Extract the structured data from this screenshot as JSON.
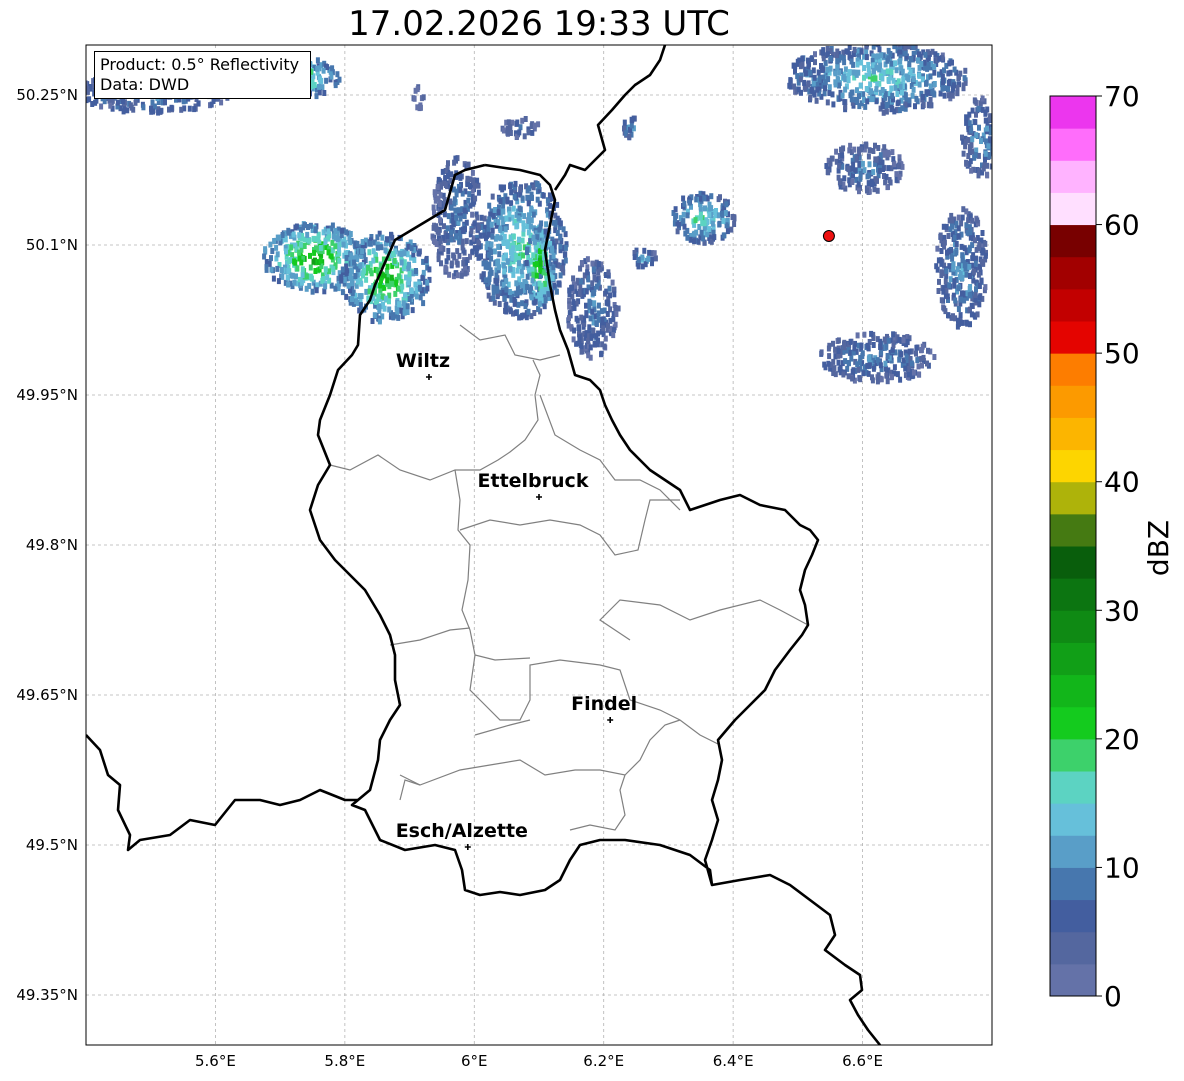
{
  "title": "17.02.2026 19:33 UTC",
  "infobox": {
    "product": "Product: 0.5° Reflectivity",
    "data_source": "Data: DWD"
  },
  "latitude_ticks": [
    {
      "value": 50.25,
      "label": "50.25°N"
    },
    {
      "value": 50.1,
      "label": "50.1°N"
    },
    {
      "value": 49.95,
      "label": "49.95°N"
    },
    {
      "value": 49.8,
      "label": "49.8°N"
    },
    {
      "value": 49.65,
      "label": "49.65°N"
    },
    {
      "value": 49.5,
      "label": "49.5°N"
    },
    {
      "value": 49.35,
      "label": "49.35°N"
    }
  ],
  "longitude_ticks": [
    {
      "value": 5.6,
      "label": "5.6°E"
    },
    {
      "value": 5.8,
      "label": "5.8°E"
    },
    {
      "value": 6.0,
      "label": "6°E"
    },
    {
      "value": 6.2,
      "label": "6.2°E"
    },
    {
      "value": 6.4,
      "label": "6.4°E"
    },
    {
      "value": 6.6,
      "label": "6.6°E"
    }
  ],
  "map_extent": {
    "lon_min": 5.4,
    "lon_max": 6.8,
    "lat_min": 49.3,
    "lat_max": 50.3
  },
  "cities": [
    {
      "name": "Wiltz",
      "lon": 5.93,
      "lat": 49.968
    },
    {
      "name": "Ettelbruck",
      "lon": 6.1,
      "lat": 49.848
    },
    {
      "name": "Findel",
      "lon": 6.21,
      "lat": 49.625
    },
    {
      "name": "Esch/Alzette",
      "lon": 5.99,
      "lat": 49.498
    }
  ],
  "radar_site": {
    "lon": 6.548,
    "lat": 50.109,
    "color": "#ee1111"
  },
  "colorbar": {
    "label": "dBZ",
    "min": 0,
    "max": 70,
    "ticks": [
      {
        "value": 0,
        "label": "0"
      },
      {
        "value": 10,
        "label": "10"
      },
      {
        "value": 20,
        "label": "20"
      },
      {
        "value": 30,
        "label": "30"
      },
      {
        "value": 40,
        "label": "40"
      },
      {
        "value": 50,
        "label": "50"
      },
      {
        "value": 60,
        "label": "60"
      },
      {
        "value": 70,
        "label": "70"
      }
    ],
    "colors": [
      "#6472a8",
      "#54679f",
      "#435e9f",
      "#4777ae",
      "#599ec8",
      "#66c0da",
      "#5cd3c2",
      "#3dd16b",
      "#14cb1e",
      "#12b61a",
      "#119f17",
      "#0f8a14",
      "#0c7511",
      "#095e0c",
      "#457a12",
      "#aeb30a",
      "#fdd500",
      "#fcb500",
      "#fc9a00",
      "#fd7d00",
      "#e40400",
      "#c20000",
      "#a20000",
      "#780000",
      "#ffdfff",
      "#ffb3ff",
      "#ff6dfb",
      "#ec36ee"
    ]
  },
  "echoes": [
    {
      "lon": 5.5,
      "lat": 50.255,
      "rx": 0.12,
      "ry": 0.02,
      "dbz": 10
    },
    {
      "lon": 5.73,
      "lat": 50.27,
      "rx": 0.06,
      "ry": 0.02,
      "dbz": 18
    },
    {
      "lon": 5.75,
      "lat": 50.09,
      "rx": 0.08,
      "ry": 0.035,
      "dbz": 22
    },
    {
      "lon": 5.86,
      "lat": 50.07,
      "rx": 0.07,
      "ry": 0.045,
      "dbz": 20
    },
    {
      "lon": 5.97,
      "lat": 50.13,
      "rx": 0.04,
      "ry": 0.06,
      "dbz": 8
    },
    {
      "lon": 6.07,
      "lat": 50.1,
      "rx": 0.07,
      "ry": 0.07,
      "dbz": 15
    },
    {
      "lon": 6.1,
      "lat": 50.08,
      "rx": 0.025,
      "ry": 0.04,
      "dbz": 22
    },
    {
      "lon": 6.18,
      "lat": 50.04,
      "rx": 0.04,
      "ry": 0.05,
      "dbz": 9
    },
    {
      "lon": 6.07,
      "lat": 50.22,
      "rx": 0.03,
      "ry": 0.01,
      "dbz": 6
    },
    {
      "lon": 6.35,
      "lat": 50.13,
      "rx": 0.05,
      "ry": 0.025,
      "dbz": 16
    },
    {
      "lon": 6.62,
      "lat": 50.27,
      "rx": 0.14,
      "ry": 0.035,
      "dbz": 14
    },
    {
      "lon": 6.6,
      "lat": 50.18,
      "rx": 0.06,
      "ry": 0.025,
      "dbz": 8
    },
    {
      "lon": 6.75,
      "lat": 50.08,
      "rx": 0.04,
      "ry": 0.06,
      "dbz": 10
    },
    {
      "lon": 6.62,
      "lat": 49.99,
      "rx": 0.09,
      "ry": 0.025,
      "dbz": 9
    },
    {
      "lon": 6.78,
      "lat": 50.21,
      "rx": 0.03,
      "ry": 0.04,
      "dbz": 10
    },
    {
      "lon": 6.26,
      "lat": 50.09,
      "rx": 0.02,
      "ry": 0.01,
      "dbz": 12
    },
    {
      "lon": 5.91,
      "lat": 50.25,
      "rx": 0.01,
      "ry": 0.012,
      "dbz": 6
    },
    {
      "lon": 6.24,
      "lat": 50.22,
      "rx": 0.015,
      "ry": 0.012,
      "dbz": 10
    }
  ]
}
